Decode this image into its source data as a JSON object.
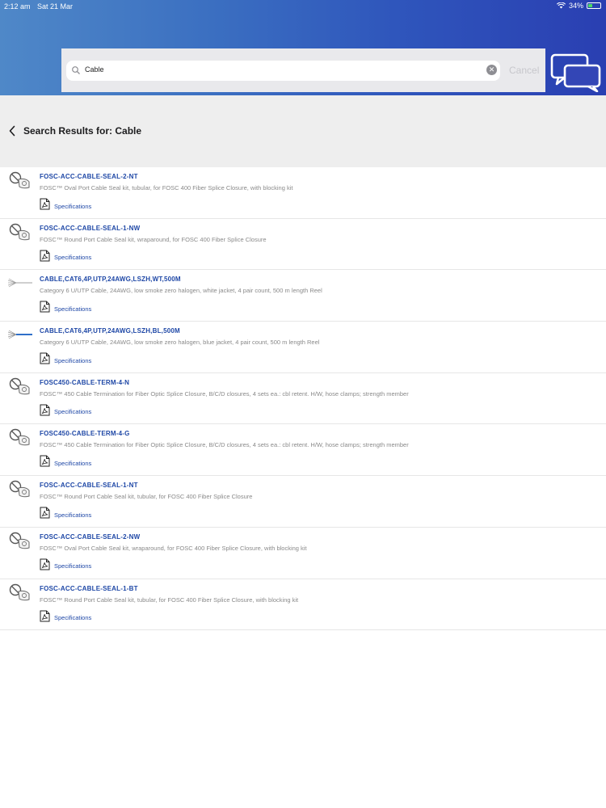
{
  "status": {
    "time": "2:12 am",
    "date": "Sat 21 Mar",
    "battery": "34%"
  },
  "search": {
    "query": "Cable",
    "cancel_label": "Cancel"
  },
  "header": {
    "title": "Search Results for: Cable"
  },
  "results": [
    {
      "code": "FOSC-ACC-CABLE-SEAL-2-NT",
      "desc": "FOSC™ Oval Port Cable Seal kit, tubular, for FOSC 400 Fiber Splice Closure, with blocking kit",
      "spec": "Specifications",
      "thumb": "seal-kit"
    },
    {
      "code": "FOSC-ACC-CABLE-SEAL-1-NW",
      "desc": "FOSC™ Round Port Cable Seal kit, wraparound, for FOSC 400 Fiber Splice Closure",
      "spec": "Specifications",
      "thumb": "seal-kit"
    },
    {
      "code": "CABLE,CAT6,4P,UTP,24AWG,LSZH,WT,500M",
      "desc": "Category 6 U/UTP Cable, 24AWG, low smoke zero halogen, white jacket, 4 pair count, 500 m length Reel",
      "spec": "Specifications",
      "thumb": "cable-white"
    },
    {
      "code": "CABLE,CAT6,4P,UTP,24AWG,LSZH,BL,500M",
      "desc": "Category 6 U/UTP Cable, 24AWG, low smoke zero halogen, blue jacket, 4 pair count, 500 m length Reel",
      "spec": "Specifications",
      "thumb": "cable-blue"
    },
    {
      "code": "FOSC450-CABLE-TERM-4-N",
      "desc": "FOSC™ 450 Cable Termination for Fiber Optic Splice Closure, B/C/D closures, 4 sets ea.: cbl retent. H/W, hose clamps; strength member",
      "spec": "Specifications",
      "thumb": "seal-kit"
    },
    {
      "code": "FOSC450-CABLE-TERM-4-G",
      "desc": "FOSC™ 450 Cable Termination for Fiber Optic Splice Closure, B/C/D closures, 4 sets ea.: cbl retent. H/W, hose clamps; strength member",
      "spec": "Specifications",
      "thumb": "seal-kit"
    },
    {
      "code": "FOSC-ACC-CABLE-SEAL-1-NT",
      "desc": "FOSC™ Round Port Cable Seal kit, tubular, for FOSC 400 Fiber Splice Closure",
      "spec": "Specifications",
      "thumb": "seal-kit"
    },
    {
      "code": "FOSC-ACC-CABLE-SEAL-2-NW",
      "desc": "FOSC™ Oval Port Cable Seal kit, wraparound, for FOSC 400 Fiber Splice Closure, with blocking kit",
      "spec": "Specifications",
      "thumb": "seal-kit"
    },
    {
      "code": "FOSC-ACC-CABLE-SEAL-1-BT",
      "desc": "FOSC™  Round Port Cable Seal kit, tubular, for FOSC 400 Fiber Splice Closure, with blocking kit",
      "spec": "Specifications",
      "thumb": "seal-kit"
    }
  ],
  "colors": {
    "link": "#1e47a6",
    "header_start": "#4f88c8",
    "header_end": "#2a3fb2"
  }
}
